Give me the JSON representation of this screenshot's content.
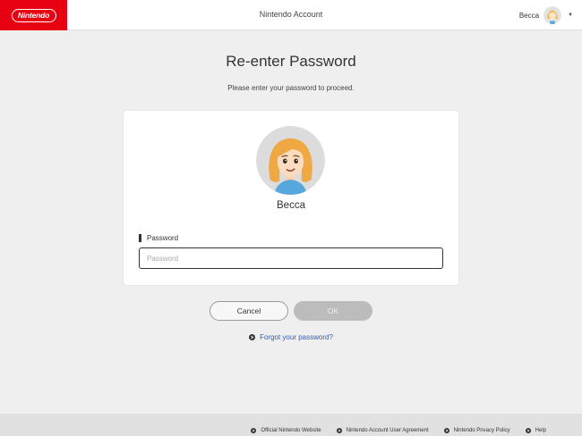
{
  "header": {
    "logo_text": "Nintendo",
    "title": "Nintendo Account",
    "user_name": "Becca",
    "caret_icon": "caret-down-icon"
  },
  "main": {
    "title": "Re-enter Password",
    "subtitle": "Please enter your password to proceed."
  },
  "card": {
    "username": "Becca",
    "password_label": "Password",
    "password_placeholder": "Password",
    "password_value": ""
  },
  "actions": {
    "cancel_label": "Cancel",
    "ok_label": "OK",
    "forgot_label": "Forgot your password?"
  },
  "footer": {
    "links": [
      {
        "label": "Official Nintendo Website"
      },
      {
        "label": "Nintendo Account User Agreement"
      },
      {
        "label": "Nintendo Privacy Policy"
      },
      {
        "label": "Help"
      }
    ]
  },
  "colors": {
    "brand_red": "#e60012",
    "link_blue": "#3b5ba8",
    "page_bg": "#efefef",
    "ok_disabled": "#bcbcbc"
  }
}
